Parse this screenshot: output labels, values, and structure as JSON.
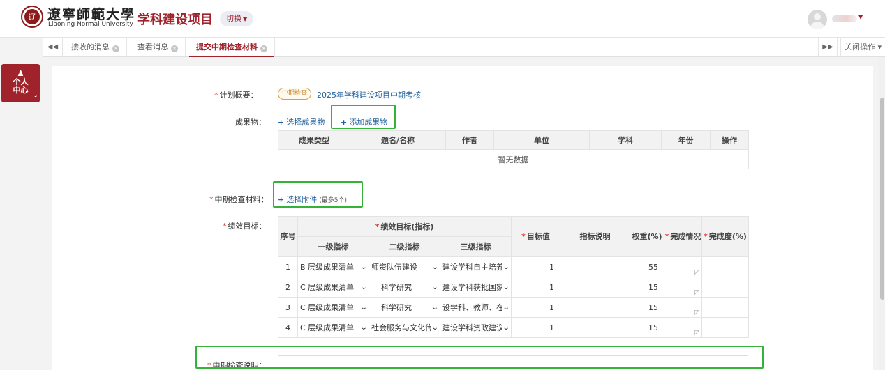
{
  "header": {
    "logo_seal_text": "辽",
    "university_cn": "遼寧師範大學",
    "university_en": "Liaoning Normal University",
    "app_title": "学科建设项目",
    "switch_label": "切换",
    "brand_color": "#a0222a"
  },
  "sidebar": {
    "personal_center_line1": "个人",
    "personal_center_line2": "中心"
  },
  "tabs": {
    "items": [
      {
        "label": "接收的消息",
        "active": false
      },
      {
        "label": "查看消息",
        "active": false
      },
      {
        "label": "提交中期检查材料",
        "active": true
      }
    ],
    "close_ops_label": "关闭操作"
  },
  "form": {
    "plan_overview_label": "计划概要：",
    "plan_tag": "中期检查",
    "plan_name": "2025年学科建设项目中期考核",
    "achievements_label": "成果物：",
    "select_achievement": "选择成果物",
    "add_achievement": "添加成果物",
    "achievements_table": {
      "columns": [
        "成果类型",
        "题名/名称",
        "作者",
        "单位",
        "学科",
        "年份",
        "操作"
      ],
      "empty_text": "暂无数据"
    },
    "midterm_materials_label": "中期检查材料：",
    "select_attachment": "选择附件",
    "attachment_hint": "(最多5个)",
    "performance_label": "绩效目标：",
    "performance_table": {
      "h_index": "序号",
      "h_goal_group": "绩效目标(指标)",
      "h_level1": "一级指标",
      "h_level2": "二级指标",
      "h_level3": "三级指标",
      "h_target": "目标值",
      "h_desc": "指标说明",
      "h_weight": "权重(%)",
      "h_completion": "完成情况",
      "h_completion_rate": "完成度(%)",
      "rows": [
        {
          "no": "1",
          "level1": "B 层级成果清单",
          "level2": "师资队伍建设",
          "level3": "建设学科自主培养",
          "target": "1",
          "desc": "",
          "weight": "55"
        },
        {
          "no": "2",
          "level1": "C 层级成果清单",
          "level2": "科学研究",
          "level3": "建设学科获批国家",
          "target": "1",
          "desc": "",
          "weight": "15"
        },
        {
          "no": "3",
          "level1": "C 层级成果清单",
          "level2": "科学研究",
          "level3": "设学科、教师、在",
          "target": "1",
          "desc": "",
          "weight": "15"
        },
        {
          "no": "4",
          "level1": "C 层级成果清单",
          "level2": "社会服务与文化传",
          "level3": "建设学科资政建议",
          "target": "1",
          "desc": "",
          "weight": "15"
        }
      ]
    },
    "midterm_note_label": "中期检查说明："
  },
  "highlight_color": "#35b338"
}
